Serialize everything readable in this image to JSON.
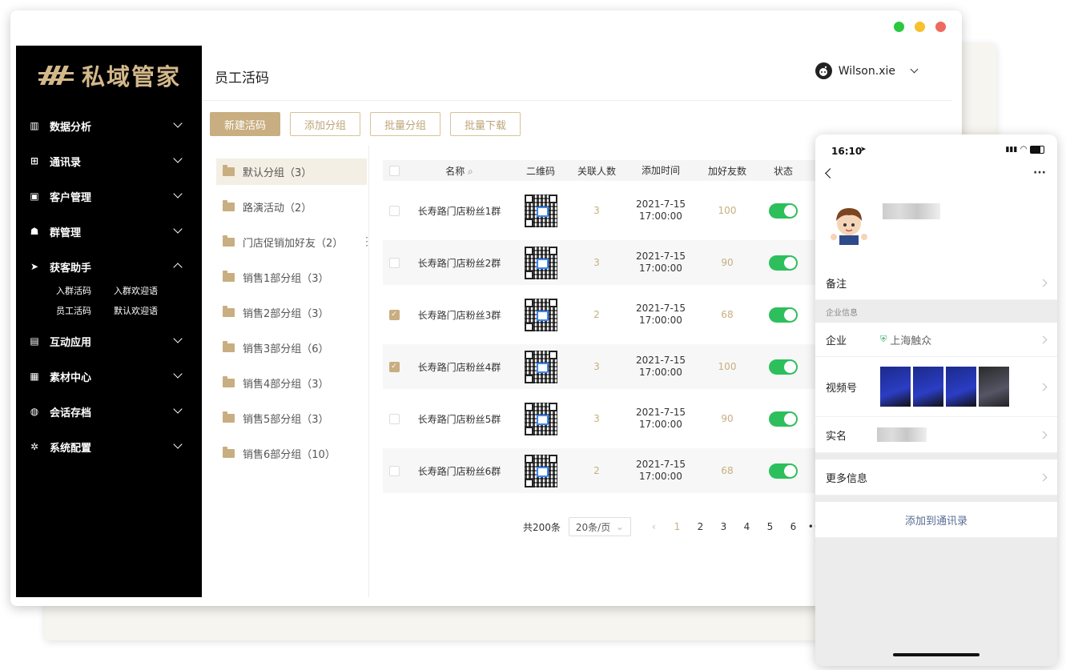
{
  "app": {
    "logo_text": "私域管家"
  },
  "sidebar": {
    "items": [
      {
        "label": "数据分析",
        "icon": "bar-chart-icon",
        "glyph": "▥",
        "expanded": false
      },
      {
        "label": "通讯录",
        "icon": "org-chart-icon",
        "glyph": "⊞",
        "expanded": false
      },
      {
        "label": "客户管理",
        "icon": "contact-card-icon",
        "glyph": "▣",
        "expanded": false
      },
      {
        "label": "群管理",
        "icon": "group-users-icon",
        "glyph": "☗",
        "expanded": false
      },
      {
        "label": "获客助手",
        "icon": "paper-plane-icon",
        "glyph": "➤",
        "expanded": true
      },
      {
        "label": "互动应用",
        "icon": "gift-icon",
        "glyph": "▤",
        "expanded": false
      },
      {
        "label": "素材中心",
        "icon": "book-icon",
        "glyph": "▦",
        "expanded": false
      },
      {
        "label": "会话存档",
        "icon": "chat-bubbles-icon",
        "glyph": "◍",
        "expanded": false
      },
      {
        "label": "系统配置",
        "icon": "gear-icon",
        "glyph": "✲",
        "expanded": false
      }
    ],
    "sub_items": [
      "入群活码",
      "入群欢迎语",
      "员工活码",
      "默认欢迎语"
    ]
  },
  "header": {
    "title": "员工活码",
    "user_name": "Wilson.xie"
  },
  "toolbar": {
    "new_code": "新建活码",
    "add_group": "添加分组",
    "batch_group": "批量分组",
    "batch_download": "批量下载"
  },
  "groups": [
    "默认分组（3）",
    "路演活动（2）",
    "门店促销加好友（2）",
    "销售1部分组（3）",
    "销售2部分组（3）",
    "销售3部分组（6）",
    "销售4部分组（3）",
    "销售5部分组（3）",
    "销售6部分组（10）"
  ],
  "table": {
    "columns": {
      "name": "名称",
      "qr": "二维码",
      "linked": "关联人数",
      "added_time": "添加时间",
      "friends": "加好友数",
      "status": "状态"
    },
    "rows": [
      {
        "name": "长寿路门店粉丝1群",
        "linked": "3",
        "date": "2021-7-15",
        "time": "17:00:00",
        "friends": "100",
        "checked": false,
        "enabled": true
      },
      {
        "name": "长寿路门店粉丝2群",
        "linked": "3",
        "date": "2021-7-15",
        "time": "17:00:00",
        "friends": "90",
        "checked": false,
        "enabled": true
      },
      {
        "name": "长寿路门店粉丝3群",
        "linked": "2",
        "date": "2021-7-15",
        "time": "17:00:00",
        "friends": "68",
        "checked": true,
        "enabled": true
      },
      {
        "name": "长寿路门店粉丝4群",
        "linked": "3",
        "date": "2021-7-15",
        "time": "17:00:00",
        "friends": "100",
        "checked": true,
        "enabled": true
      },
      {
        "name": "长寿路门店粉丝5群",
        "linked": "3",
        "date": "2021-7-15",
        "time": "17:00:00",
        "friends": "90",
        "checked": false,
        "enabled": true
      },
      {
        "name": "长寿路门店粉丝6群",
        "linked": "2",
        "date": "2021-7-15",
        "time": "17:00:00",
        "friends": "68",
        "checked": false,
        "enabled": true
      }
    ]
  },
  "pager": {
    "total": "共200条",
    "page_size": "20条/页",
    "pages": [
      "1",
      "2",
      "3",
      "4",
      "5",
      "6"
    ],
    "current": "1",
    "more": "•••"
  },
  "phone": {
    "time": "16:10",
    "remark_label": "备注",
    "section_label": "企业信息",
    "company_label": "企业",
    "company_value": "上海触众",
    "video_label": "视频号",
    "realname_label": "实名",
    "more_label": "更多信息",
    "add_contact": "添加到通讯录"
  },
  "colors": {
    "accent": "#c8ae80",
    "toggle_on": "#2dbf5c",
    "sidebar_bg": "#000000"
  }
}
